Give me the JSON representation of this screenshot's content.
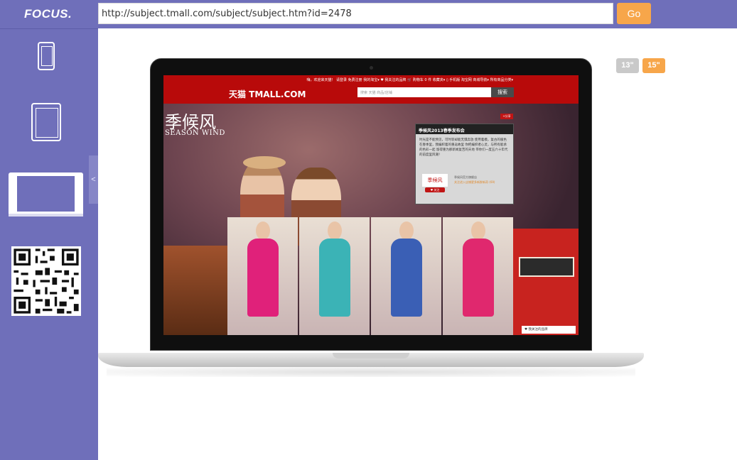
{
  "app": {
    "logo": "FOCUS."
  },
  "toolbar": {
    "url": "http://subject.tmall.com/subject/subject.htm?id=2478",
    "go_label": "Go"
  },
  "sidebar": {
    "collapse_label": "<",
    "devices": [
      "phone",
      "tablet",
      "laptop",
      "qr-code"
    ],
    "selected": "laptop"
  },
  "sizes": {
    "small": "13\"",
    "large": "15\"",
    "selected": "large"
  },
  "preview": {
    "topbar_links": "嗨，欢迎来天猫！  请登录  免费注册      我的淘宝▾   ♥ 我关注的品牌   🛒 购物车 0 件   收藏夹▾   ▯ 手机版  淘宝网  商城导航▾  所有商品分类▾",
    "logo": "天猫 TMALL.COM",
    "search_placeholder": "搜索 天猫 商品/店铺",
    "search_button": "搜索",
    "hero_title": "季候风",
    "hero_subtitle": "SEASON WIND",
    "share_label": "+分享",
    "popup_title": "季候风2013春季发布会",
    "popup_body": "时光是不能预见，可时装却能无惧奔放 使用着模，复古的服色在春季里，我编织着的重返故里 你把编织者心灵，与所有能承的色彩一起 留得重为那新闻复苦的天地 带你们一度五六十年代的前度里风潮！",
    "card_logo": "季候风",
    "card_follow": "♥ 关注",
    "card_line1": "季候风官方旗舰店",
    "card_line2": "关注进入店铺更多新鲜新奇 (69)",
    "follow_brand": "♥ 我关注的品牌"
  },
  "colors": {
    "accent": "#6f6fba",
    "button": "#f7a64a",
    "tmall_red": "#b80a0a"
  }
}
